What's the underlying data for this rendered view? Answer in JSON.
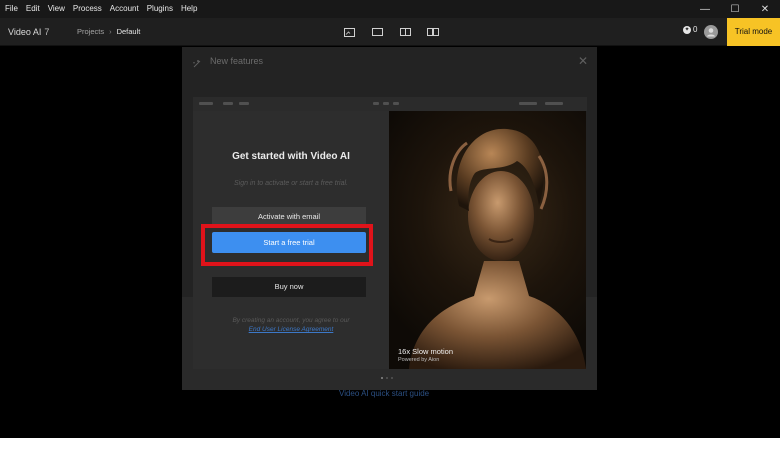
{
  "menubar": {
    "items": [
      "File",
      "Edit",
      "View",
      "Process",
      "Account",
      "Plugins",
      "Help"
    ]
  },
  "window_controls": {
    "minimize": "—",
    "maximize": "☐",
    "close": "✕"
  },
  "appbar": {
    "title": "Video AI",
    "version": "7",
    "breadcrumb": {
      "projects": "Projects",
      "separator": "›",
      "current": "Default"
    },
    "credits": "0",
    "trial_label": "Trial mode"
  },
  "background": {
    "title": "New features",
    "close": "✕",
    "link": "Video AI quick start guide"
  },
  "modal": {
    "title": "Get started with Video AI",
    "subtitle": "Sign in to activate or start a free trial.",
    "activate_label": "Activate with email",
    "trial_label": "Start a free trial",
    "buy_label": "Buy now",
    "terms_text": "By creating an account, you agree to our",
    "terms_link": "End User License Agreement"
  },
  "feature_preview": {
    "title": "16x Slow motion",
    "subtitle": "Powered by Aion"
  },
  "colors": {
    "accent": "#3d8ff0",
    "trial": "#f7c325",
    "highlight": "#e0131a"
  }
}
